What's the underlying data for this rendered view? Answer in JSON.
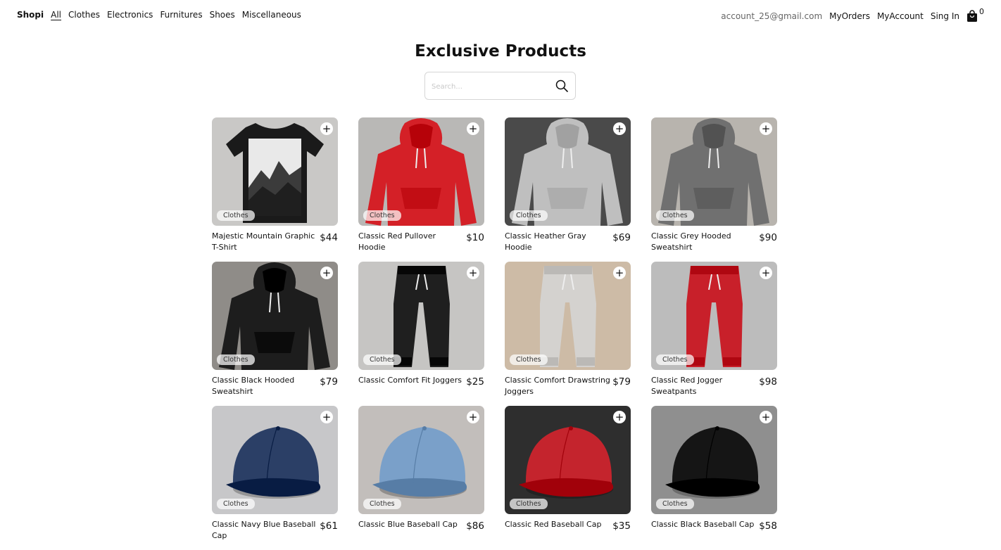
{
  "nav": {
    "brand": "Shopi",
    "categories": [
      "All",
      "Clothes",
      "Electronics",
      "Furnitures",
      "Shoes",
      "Miscellaneous"
    ],
    "active_category": "All",
    "email": "account_25@gmail.com",
    "my_orders": "MyOrders",
    "my_account": "MyAccount",
    "sign_in": "Sing In",
    "cart_count": "0"
  },
  "header": {
    "title": "Exclusive Products",
    "search_placeholder": "Search..."
  },
  "add_symbol": "+",
  "products": [
    {
      "name": "Majestic Mountain Graphic T-Shirt",
      "price": "$44",
      "category": "Clothes",
      "image": "black-tshirt",
      "bg": "#c9c8c6",
      "item": "#1a1a1a"
    },
    {
      "name": "Classic Red Pullover Hoodie",
      "price": "$10",
      "category": "Clothes",
      "image": "red-hoodie",
      "bg": "#b9b8b6",
      "item": "#d42027"
    },
    {
      "name": "Classic Heather Gray Hoodie",
      "price": "$69",
      "category": "Clothes",
      "image": "gray-hoodie",
      "bg": "#4a4a4a",
      "item": "#bfbfbf"
    },
    {
      "name": "Classic Grey Hooded Sweatshirt",
      "price": "$90",
      "category": "Clothes",
      "image": "grey-hoodie",
      "bg": "#b8b4ae",
      "item": "#707070"
    },
    {
      "name": "Classic Black Hooded Sweatshirt",
      "price": "$79",
      "category": "Clothes",
      "image": "black-hoodie",
      "bg": "#8f8c88",
      "item": "#1d1d1d"
    },
    {
      "name": "Classic Comfort Fit Joggers",
      "price": "$25",
      "category": "Clothes",
      "image": "black-joggers",
      "bg": "#c6c5c3",
      "item": "#1f1f1f"
    },
    {
      "name": "Classic Comfort Drawstring Joggers",
      "price": "$79",
      "category": "Clothes",
      "image": "gray-joggers",
      "bg": "#cdbba6",
      "item": "#d4d2cf"
    },
    {
      "name": "Classic Red Jogger Sweatpants",
      "price": "$98",
      "category": "Clothes",
      "image": "red-joggers",
      "bg": "#bcbcbc",
      "item": "#c8202a"
    },
    {
      "name": "Classic Navy Blue Baseball Cap",
      "price": "$61",
      "category": "Clothes",
      "image": "navy-cap",
      "bg": "#c7c7c9",
      "item": "#2b3f66"
    },
    {
      "name": "Classic Blue Baseball Cap",
      "price": "$86",
      "category": "Clothes",
      "image": "blue-cap",
      "bg": "#c2bebb",
      "item": "#7aa0c9"
    },
    {
      "name": "Classic Red Baseball Cap",
      "price": "$35",
      "category": "Clothes",
      "image": "red-cap",
      "bg": "#2e2e2e",
      "item": "#c4242d"
    },
    {
      "name": "Classic Black Baseball Cap",
      "price": "$58",
      "category": "Clothes",
      "image": "black-cap",
      "bg": "#8f8f8f",
      "item": "#151515"
    }
  ]
}
